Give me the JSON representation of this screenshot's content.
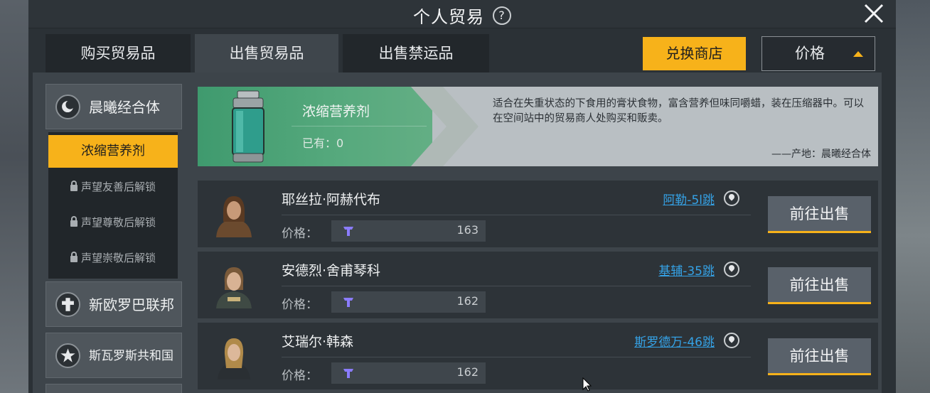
{
  "window": {
    "title": "个人贸易",
    "help": "?"
  },
  "tabs": [
    {
      "label": "购买贸易品",
      "active": false
    },
    {
      "label": "出售贸易品",
      "active": true
    },
    {
      "label": "出售禁运品",
      "active": false
    }
  ],
  "toolbar": {
    "exchange_shop": "兑换商店",
    "sort_label": "价格"
  },
  "sidebar": {
    "factions": [
      {
        "name": "晨曦经合体",
        "icon": "dawn-emblem-icon"
      },
      {
        "name": "新欧罗巴联邦",
        "icon": "cross-emblem-icon"
      },
      {
        "name": "斯瓦罗斯共和国",
        "icon": "star-emblem-icon"
      }
    ],
    "items": [
      {
        "label": "浓缩营养剂",
        "active": true,
        "locked": false
      },
      {
        "label": "声望友善后解锁",
        "active": false,
        "locked": true
      },
      {
        "label": "声望尊敬后解锁",
        "active": false,
        "locked": true
      },
      {
        "label": "声望崇敬后解锁",
        "active": false,
        "locked": true
      }
    ]
  },
  "product": {
    "name": "浓缩营养剂",
    "owned": "已有：0",
    "description": "适合在失重状态的下食用的膏状食物，富含营养但味同嚼蜡，装在压缩器中。可以在空间站中的贸易商人处购买和贩卖。",
    "origin": "——产地：晨曦经合体"
  },
  "traders": [
    {
      "name": "耶丝拉·阿赫代布",
      "location": "阿勒-5l跳",
      "price_label": "价格：",
      "price": "163",
      "action": "前往出售"
    },
    {
      "name": "安德烈·舍甫琴科",
      "location": "基辅-35跳",
      "price_label": "价格：",
      "price": "162",
      "action": "前往出售"
    },
    {
      "name": "艾瑞尔·韩森",
      "location": "斯罗德万-46跳",
      "price_label": "价格：",
      "price": "162",
      "action": "前往出售"
    }
  ],
  "colors": {
    "accent": "#f7b21a",
    "link": "#35a2e6",
    "banner_green": "#4fa577"
  }
}
